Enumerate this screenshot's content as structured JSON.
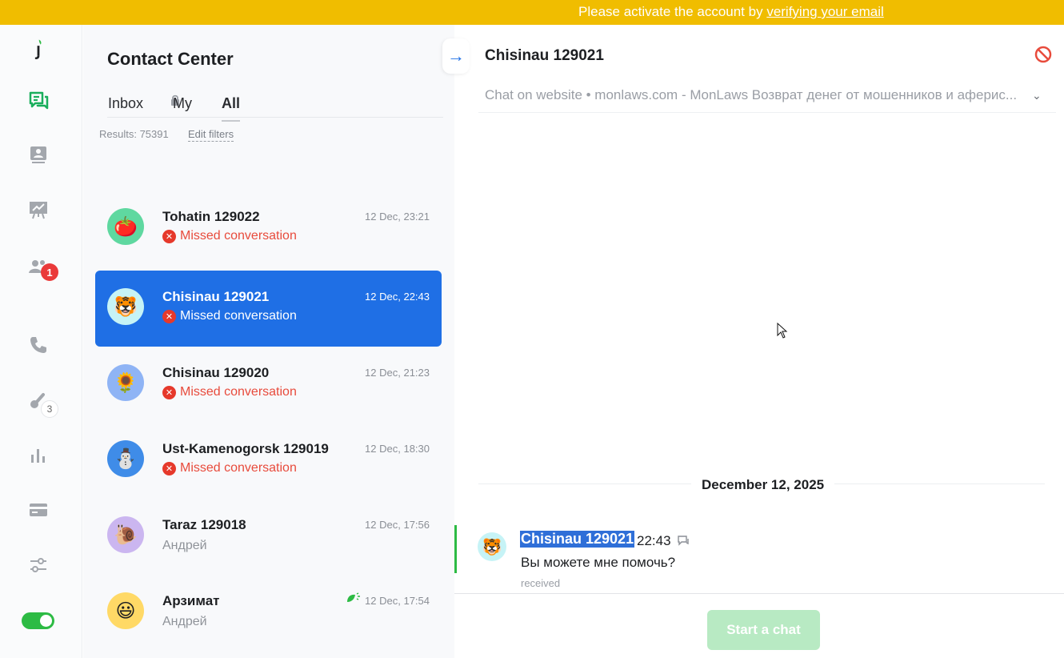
{
  "banner": {
    "text": "Please activate the account by ",
    "link": "verifying your email",
    "color": "#f0bd00"
  },
  "rail": {
    "items": [
      {
        "icon": "logo-icon"
      },
      {
        "icon": "chats-icon",
        "active": true
      },
      {
        "icon": "contact-card-icon"
      },
      {
        "icon": "presentation-chart-icon"
      },
      {
        "icon": "team-icon",
        "badge": "1"
      },
      {
        "icon": "phone-icon"
      },
      {
        "icon": "integrations-icon",
        "badge": "3"
      },
      {
        "icon": "bar-chart-icon"
      },
      {
        "icon": "billing-card-icon"
      },
      {
        "icon": "settings-sliders-icon"
      }
    ],
    "online": true,
    "accent": "#2dbb44"
  },
  "contact_center": {
    "title": "Contact Center",
    "tabs": [
      {
        "label": "Inbox",
        "locked": true
      },
      {
        "label": "My"
      },
      {
        "label": "All",
        "active": true
      }
    ],
    "results": "Results: 75391",
    "edit_filters": "Edit filters",
    "conversations": [
      {
        "name": "Tohatin 129022",
        "time": "12 Dec, 23:21",
        "status": "Missed conversation",
        "avatar": "🍅",
        "avatar_bg": "#5fd8a0"
      },
      {
        "name": "Chisinau 129021",
        "time": "12 Dec, 22:43",
        "status": "Missed conversation",
        "avatar": "🐯",
        "avatar_bg": "#c6f3f6",
        "selected": true
      },
      {
        "name": "Chisinau 129020",
        "time": "12 Dec, 21:23",
        "status": "Missed conversation",
        "avatar": "🌻",
        "avatar_bg": "#8fb4f5"
      },
      {
        "name": "Ust-Kamenogorsk 129019",
        "time": "12 Dec, 18:30",
        "status": "Missed conversation",
        "avatar": "⛄",
        "avatar_bg": "#3f8ce8"
      },
      {
        "name": "Taraz 129018",
        "time": "12 Dec, 17:56",
        "sub": "Андрей",
        "avatar": "🐌",
        "avatar_bg": "#cbb6f0"
      },
      {
        "name": "Арзимат",
        "time": "12 Dec, 17:54",
        "sub": "Андрей",
        "avatar": "😃",
        "avatar_bg": "#ffd966",
        "leaf": true
      }
    ]
  },
  "chat": {
    "title": "Chisinau 129021",
    "source": "Chat on website • monlaws.com - MonLaws Возврат денег от мошенников и аферис...",
    "date": "December 12, 2025",
    "message": {
      "sender": "Chisinau 129021",
      "time": "22:43",
      "text": "Вы можете мне помочь?",
      "state": "received",
      "avatar": "🐯"
    },
    "start_chat": "Start a chat",
    "primary_color": "#1f6fe5"
  }
}
